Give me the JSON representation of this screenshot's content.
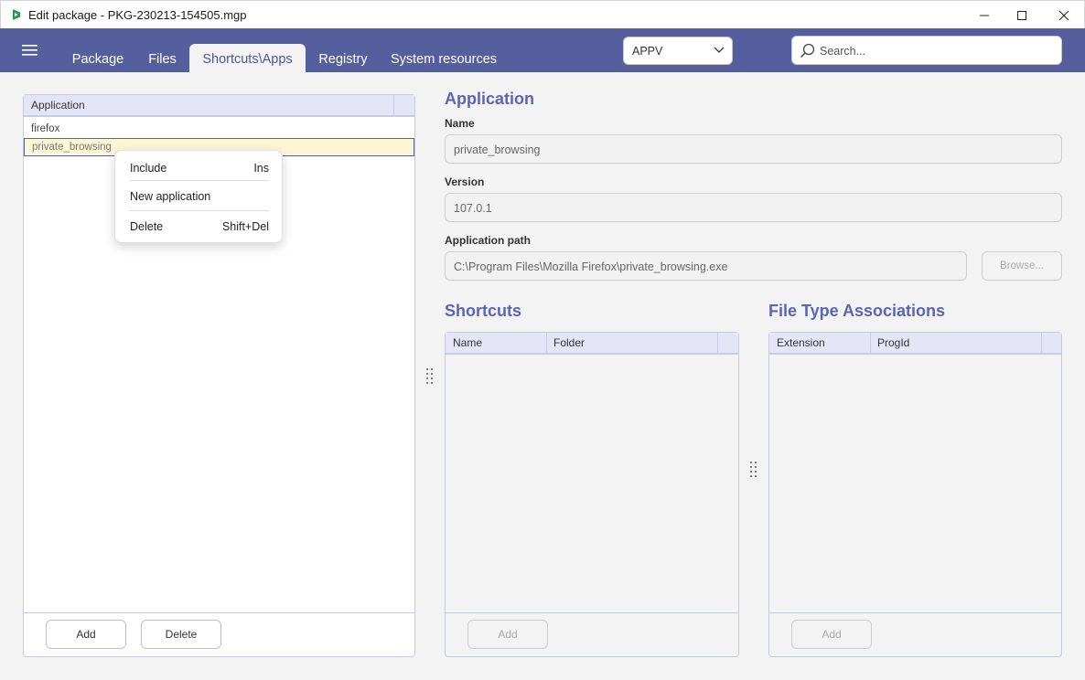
{
  "window": {
    "title": "Edit package - PKG-230213-154505.mgp"
  },
  "nav": {
    "tabs": [
      {
        "label": "Package"
      },
      {
        "label": "Files"
      },
      {
        "label": "Shortcuts\\Apps"
      },
      {
        "label": "Registry"
      },
      {
        "label": "System resources"
      }
    ],
    "active_tab": "Shortcuts\\Apps",
    "format_select": "APPV",
    "search_placeholder": "Search..."
  },
  "app_list": {
    "header": "Application",
    "rows": [
      "firefox",
      "private_browsing"
    ],
    "selected": "private_browsing",
    "add_label": "Add",
    "delete_label": "Delete"
  },
  "context_menu": {
    "items": [
      {
        "label": "Include",
        "shortcut": "Ins"
      },
      {
        "label": "New application",
        "shortcut": ""
      },
      {
        "label": "Delete",
        "shortcut": "Shift+Del"
      }
    ]
  },
  "application": {
    "title": "Application",
    "name_label": "Name",
    "name_value": "private_browsing",
    "version_label": "Version",
    "version_value": "107.0.1",
    "path_label": "Application path",
    "path_value": "C:\\Program Files\\Mozilla Firefox\\private_browsing.exe",
    "browse_label": "Browse..."
  },
  "shortcuts": {
    "title": "Shortcuts",
    "columns": [
      "Name",
      "Folder"
    ],
    "add_label": "Add"
  },
  "fta": {
    "title": "File Type Associations",
    "columns": [
      "Extension",
      "ProgId"
    ],
    "add_label": "Add"
  },
  "colors": {
    "nav_bg": "#565f9e",
    "accent": "#5a65b8",
    "header_bg": "#e4e6f7",
    "selection_bg": "#fdf6d4"
  }
}
